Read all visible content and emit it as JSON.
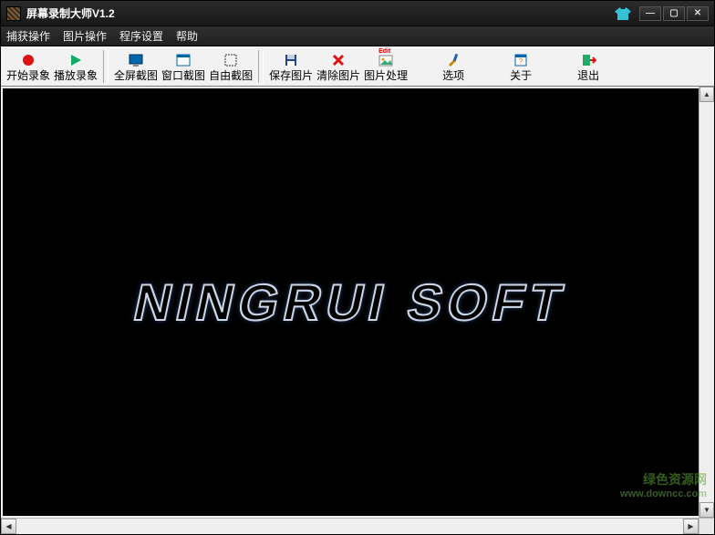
{
  "window": {
    "title": "屏幕录制大师V1.2"
  },
  "menubar": {
    "items": [
      "捕获操作",
      "图片操作",
      "程序设置",
      "帮助"
    ]
  },
  "toolbar": {
    "start_record": "开始录象",
    "play_record": "播放录象",
    "fullscreen_shot": "全屏截图",
    "window_shot": "窗口截图",
    "free_shot": "自由截图",
    "save_image": "保存图片",
    "clear_image": "清除图片",
    "image_edit": "图片处理",
    "image_edit_badge": "Edit",
    "options": "选项",
    "about": "关于",
    "exit": "退出"
  },
  "canvas": {
    "logo_text": "NINGRUI SOFT"
  },
  "watermark": {
    "line1": "绿色资源网",
    "line2": "www.downcc.com"
  }
}
